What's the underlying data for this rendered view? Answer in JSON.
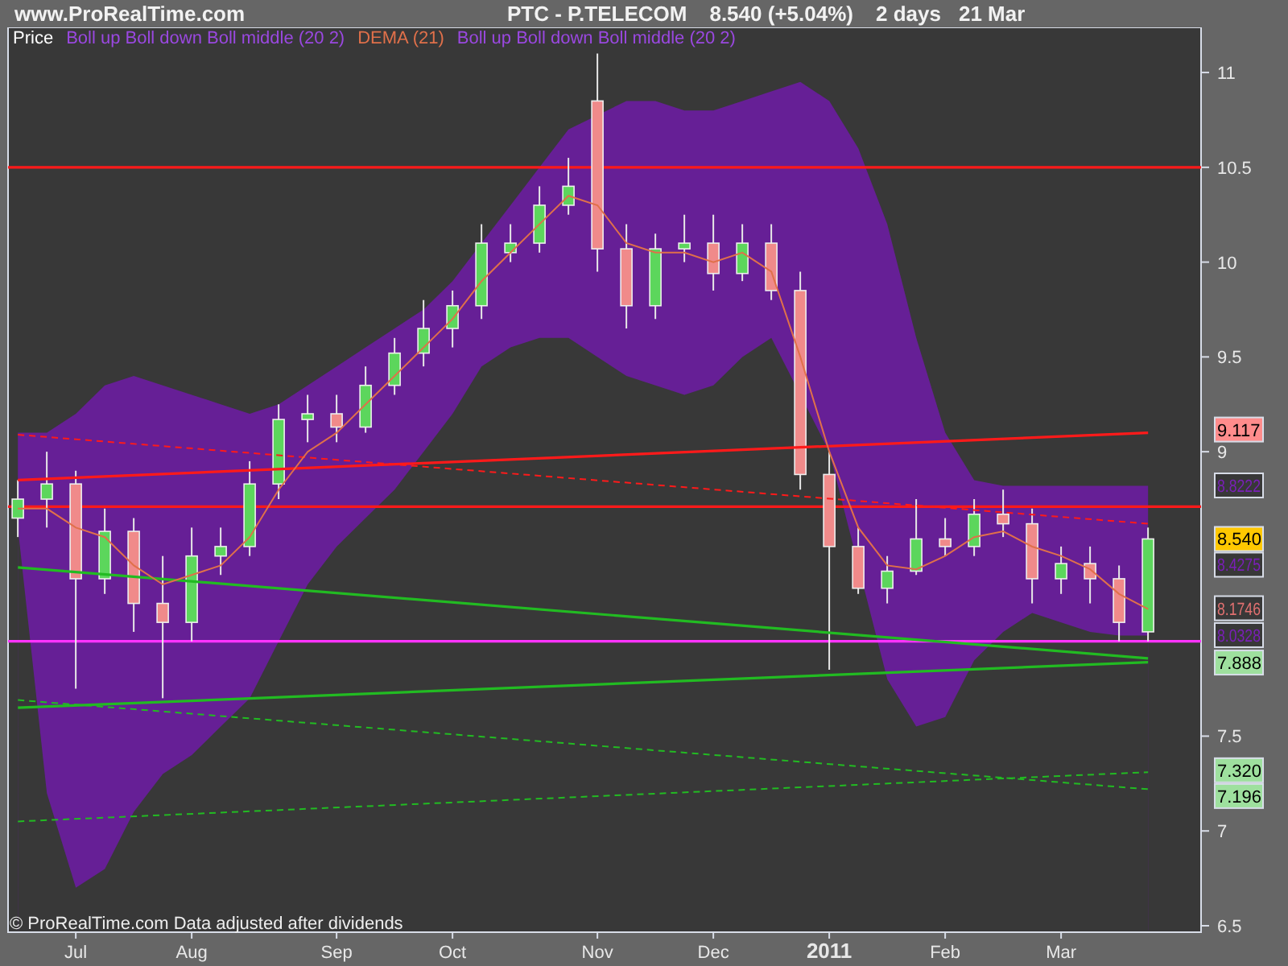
{
  "header": {
    "site": "www.ProRealTime.com",
    "instrument": "PTC - P.TELECOM",
    "quote": "8.540 (+5.04%)",
    "period": "2 days",
    "date": "21 Mar"
  },
  "price_labels": [
    {
      "text": "9.117",
      "kind": "filled",
      "color": "#ff8c8c"
    },
    {
      "text": "8.8222",
      "kind": "outlined",
      "color": "#7a1fb8"
    },
    {
      "text": "8.540",
      "kind": "filled",
      "color": "#ffc800"
    },
    {
      "text": "8.4275",
      "kind": "outlined",
      "color": "#7a1fb8"
    },
    {
      "text": "8.1746",
      "kind": "outlined",
      "color": "#e07070"
    },
    {
      "text": "8.0328",
      "kind": "outlined",
      "color": "#7a1fb8"
    },
    {
      "text": "7.888",
      "kind": "filled",
      "color": "#9ee09e"
    },
    {
      "text": "7.320",
      "kind": "filled",
      "color": "#9ee09e"
    },
    {
      "text": "7.196",
      "kind": "filled",
      "color": "#9ee09e"
    }
  ],
  "chart": {
    "footnote": "© ProRealTime.com Data adjusted after dividends",
    "chart_data": {
      "type": "candlestick",
      "categories": [
        null,
        null,
        "Jul",
        null,
        null,
        null,
        "Aug",
        null,
        null,
        null,
        null,
        "Sep",
        null,
        null,
        null,
        "Oct",
        null,
        null,
        null,
        null,
        "Nov",
        null,
        null,
        null,
        "Dec",
        null,
        null,
        null,
        "2011",
        null,
        null,
        null,
        "Feb",
        null,
        null,
        null,
        "Mar",
        null,
        null,
        null
      ],
      "ylim": [
        6.466,
        11.238
      ],
      "yticks": [
        {
          "value": 11,
          "label": "11"
        },
        {
          "value": 10.5,
          "label": "10.5"
        },
        {
          "value": 10,
          "label": "10"
        },
        {
          "value": 9.5,
          "label": "9.5"
        },
        {
          "value": 9,
          "label": "9"
        },
        {
          "value": 7.5,
          "label": "7.5"
        },
        {
          "value": 7,
          "label": "7"
        },
        {
          "value": 6.5,
          "label": "6.5"
        }
      ],
      "series": [
        {
          "name": "Price",
          "type": "candlestick",
          "ohlc": [
            [
              8.65,
              8.85,
              8.55,
              8.75
            ],
            [
              8.75,
              9.0,
              8.6,
              8.83
            ],
            [
              8.83,
              8.9,
              7.75,
              8.33
            ],
            [
              8.33,
              8.7,
              8.25,
              8.58
            ],
            [
              8.58,
              8.65,
              8.05,
              8.2
            ],
            [
              8.2,
              8.45,
              7.7,
              8.1
            ],
            [
              8.1,
              8.6,
              8.0,
              8.45
            ],
            [
              8.45,
              8.6,
              8.35,
              8.5
            ],
            [
              8.5,
              8.95,
              8.45,
              8.83
            ],
            [
              8.83,
              9.25,
              8.75,
              9.17
            ],
            [
              9.17,
              9.3,
              9.05,
              9.2
            ],
            [
              9.2,
              9.3,
              9.05,
              9.13
            ],
            [
              9.13,
              9.45,
              9.1,
              9.35
            ],
            [
              9.35,
              9.6,
              9.3,
              9.52
            ],
            [
              9.52,
              9.8,
              9.45,
              9.65
            ],
            [
              9.65,
              9.85,
              9.55,
              9.77
            ],
            [
              9.77,
              10.2,
              9.7,
              10.1
            ],
            [
              10.05,
              10.2,
              10.0,
              10.1
            ],
            [
              10.1,
              10.4,
              10.05,
              10.3
            ],
            [
              10.3,
              10.55,
              10.25,
              10.4
            ],
            [
              10.85,
              11.1,
              9.95,
              10.07
            ],
            [
              10.07,
              10.2,
              9.65,
              9.77
            ],
            [
              9.77,
              10.15,
              9.7,
              10.07
            ],
            [
              10.07,
              10.25,
              10.0,
              10.1
            ],
            [
              10.1,
              10.25,
              9.85,
              9.94
            ],
            [
              9.94,
              10.2,
              9.9,
              10.1
            ],
            [
              10.1,
              10.2,
              9.8,
              9.85
            ],
            [
              9.85,
              9.95,
              8.8,
              8.88
            ],
            [
              8.88,
              9.0,
              7.85,
              8.5
            ],
            [
              8.5,
              8.6,
              8.25,
              8.28
            ],
            [
              8.28,
              8.45,
              8.2,
              8.37
            ],
            [
              8.37,
              8.75,
              8.35,
              8.54
            ],
            [
              8.54,
              8.65,
              8.45,
              8.5
            ],
            [
              8.5,
              8.75,
              8.45,
              8.67
            ],
            [
              8.67,
              8.8,
              8.55,
              8.62
            ],
            [
              8.62,
              8.7,
              8.2,
              8.33
            ],
            [
              8.33,
              8.5,
              8.25,
              8.41
            ],
            [
              8.41,
              8.5,
              8.2,
              8.33
            ],
            [
              8.33,
              8.4,
              8.0,
              8.1
            ],
            [
              8.05,
              8.6,
              8.0,
              8.54
            ]
          ]
        },
        {
          "name": "Boll up Boll down Boll middle (20 2)",
          "type": "area",
          "color": "#661f96",
          "values": [
            9.1,
            9.1,
            9.2,
            9.35,
            9.4,
            9.35,
            9.3,
            9.25,
            9.2,
            9.25,
            9.35,
            9.45,
            9.55,
            9.65,
            9.75,
            9.9,
            10.1,
            10.3,
            10.5,
            10.7,
            null,
            10.85,
            10.85,
            10.8,
            10.8,
            10.85,
            10.9,
            10.95,
            10.85,
            10.6,
            10.2,
            9.6,
            9.1,
            8.85,
            8.82,
            8.82,
            8.82,
            8.82,
            8.82,
            8.82
          ]
        },
        {
          "name": "DEMA (21)",
          "type": "line",
          "color": "#e0704a",
          "values": [
            8.7,
            8.7,
            8.6,
            8.55,
            8.4,
            8.3,
            8.35,
            8.4,
            8.55,
            8.8,
            9.0,
            9.1,
            9.25,
            9.4,
            9.55,
            9.7,
            9.9,
            10.05,
            10.2,
            10.35,
            10.3,
            10.1,
            10.05,
            10.05,
            10.0,
            10.05,
            9.95,
            9.5,
            9.0,
            8.6,
            8.4,
            8.38,
            8.45,
            8.55,
            8.58,
            8.5,
            8.45,
            8.38,
            8.25,
            8.17
          ]
        },
        {
          "name": "Boll up Boll down Boll middle (20 2)",
          "type": "area",
          "color": "#383838",
          "values": [
            8.6,
            7.2,
            6.7,
            6.8,
            7.1,
            7.3,
            7.4,
            7.55,
            7.7,
            8.0,
            8.3,
            8.5,
            8.65,
            8.8,
            9.0,
            9.2,
            9.45,
            9.55,
            9.6,
            9.6,
            9.5,
            9.4,
            9.35,
            9.3,
            9.35,
            9.5,
            9.6,
            null,
            9.0,
            null,
            7.8,
            7.55,
            7.6,
            7.9,
            8.05,
            8.15,
            8.1,
            8.05,
            8.03,
            8.03
          ]
        },
        {
          "type": "line",
          "color": "#ff1a1a",
          "values": [
            8.85,
            null,
            null,
            null,
            null,
            null,
            null,
            null,
            null,
            null,
            null,
            null,
            null,
            null,
            null,
            null,
            null,
            null,
            null,
            null,
            null,
            null,
            null,
            null,
            null,
            null,
            null,
            null,
            null,
            null,
            null,
            null,
            null,
            null,
            null,
            null,
            null,
            null,
            null,
            9.1
          ]
        },
        {
          "type": "line",
          "color": "#ff1a1a",
          "line_style": "dashed",
          "values": [
            9.09,
            null,
            null,
            null,
            null,
            null,
            null,
            null,
            null,
            null,
            null,
            null,
            null,
            null,
            null,
            null,
            null,
            null,
            null,
            null,
            null,
            null,
            null,
            null,
            null,
            null,
            null,
            null,
            null,
            null,
            null,
            null,
            null,
            null,
            null,
            null,
            null,
            null,
            null,
            8.62
          ]
        },
        {
          "type": "line",
          "color": "#22bb22",
          "values": [
            8.39,
            null,
            null,
            null,
            null,
            null,
            null,
            null,
            null,
            null,
            null,
            null,
            null,
            null,
            null,
            null,
            null,
            null,
            null,
            null,
            null,
            null,
            null,
            null,
            null,
            null,
            null,
            null,
            null,
            null,
            null,
            null,
            null,
            null,
            null,
            null,
            null,
            null,
            null,
            7.91
          ]
        },
        {
          "type": "line",
          "color": "#22bb22",
          "values": [
            7.65,
            null,
            null,
            null,
            null,
            null,
            null,
            null,
            null,
            null,
            null,
            null,
            null,
            null,
            null,
            null,
            null,
            null,
            null,
            null,
            null,
            null,
            null,
            null,
            null,
            null,
            null,
            null,
            null,
            null,
            null,
            null,
            null,
            null,
            null,
            null,
            null,
            null,
            null,
            7.89
          ]
        },
        {
          "type": "line",
          "color": "#22bb22",
          "line_style": "dashed",
          "values": [
            7.69,
            null,
            null,
            null,
            null,
            null,
            null,
            null,
            null,
            null,
            null,
            null,
            null,
            null,
            null,
            null,
            null,
            null,
            null,
            null,
            null,
            null,
            null,
            null,
            null,
            null,
            null,
            null,
            null,
            null,
            null,
            null,
            null,
            null,
            null,
            null,
            null,
            null,
            null,
            7.22
          ]
        },
        {
          "type": "line",
          "color": "#22bb22",
          "line_style": "dashed",
          "values": [
            7.05,
            null,
            null,
            null,
            null,
            null,
            null,
            null,
            null,
            null,
            null,
            null,
            null,
            null,
            null,
            null,
            null,
            null,
            null,
            null,
            null,
            null,
            null,
            null,
            null,
            null,
            null,
            null,
            null,
            null,
            null,
            null,
            null,
            null,
            null,
            null,
            null,
            null,
            null,
            7.31
          ]
        }
      ],
      "ref_lines": [
        {
          "axis": "y",
          "value": 10.5,
          "color": "#ff1a1a"
        },
        {
          "axis": "y",
          "value": 8.71,
          "color": "#ff1a1a"
        },
        {
          "axis": "y",
          "value": 8.0,
          "color": "#ff33ff"
        }
      ]
    }
  }
}
